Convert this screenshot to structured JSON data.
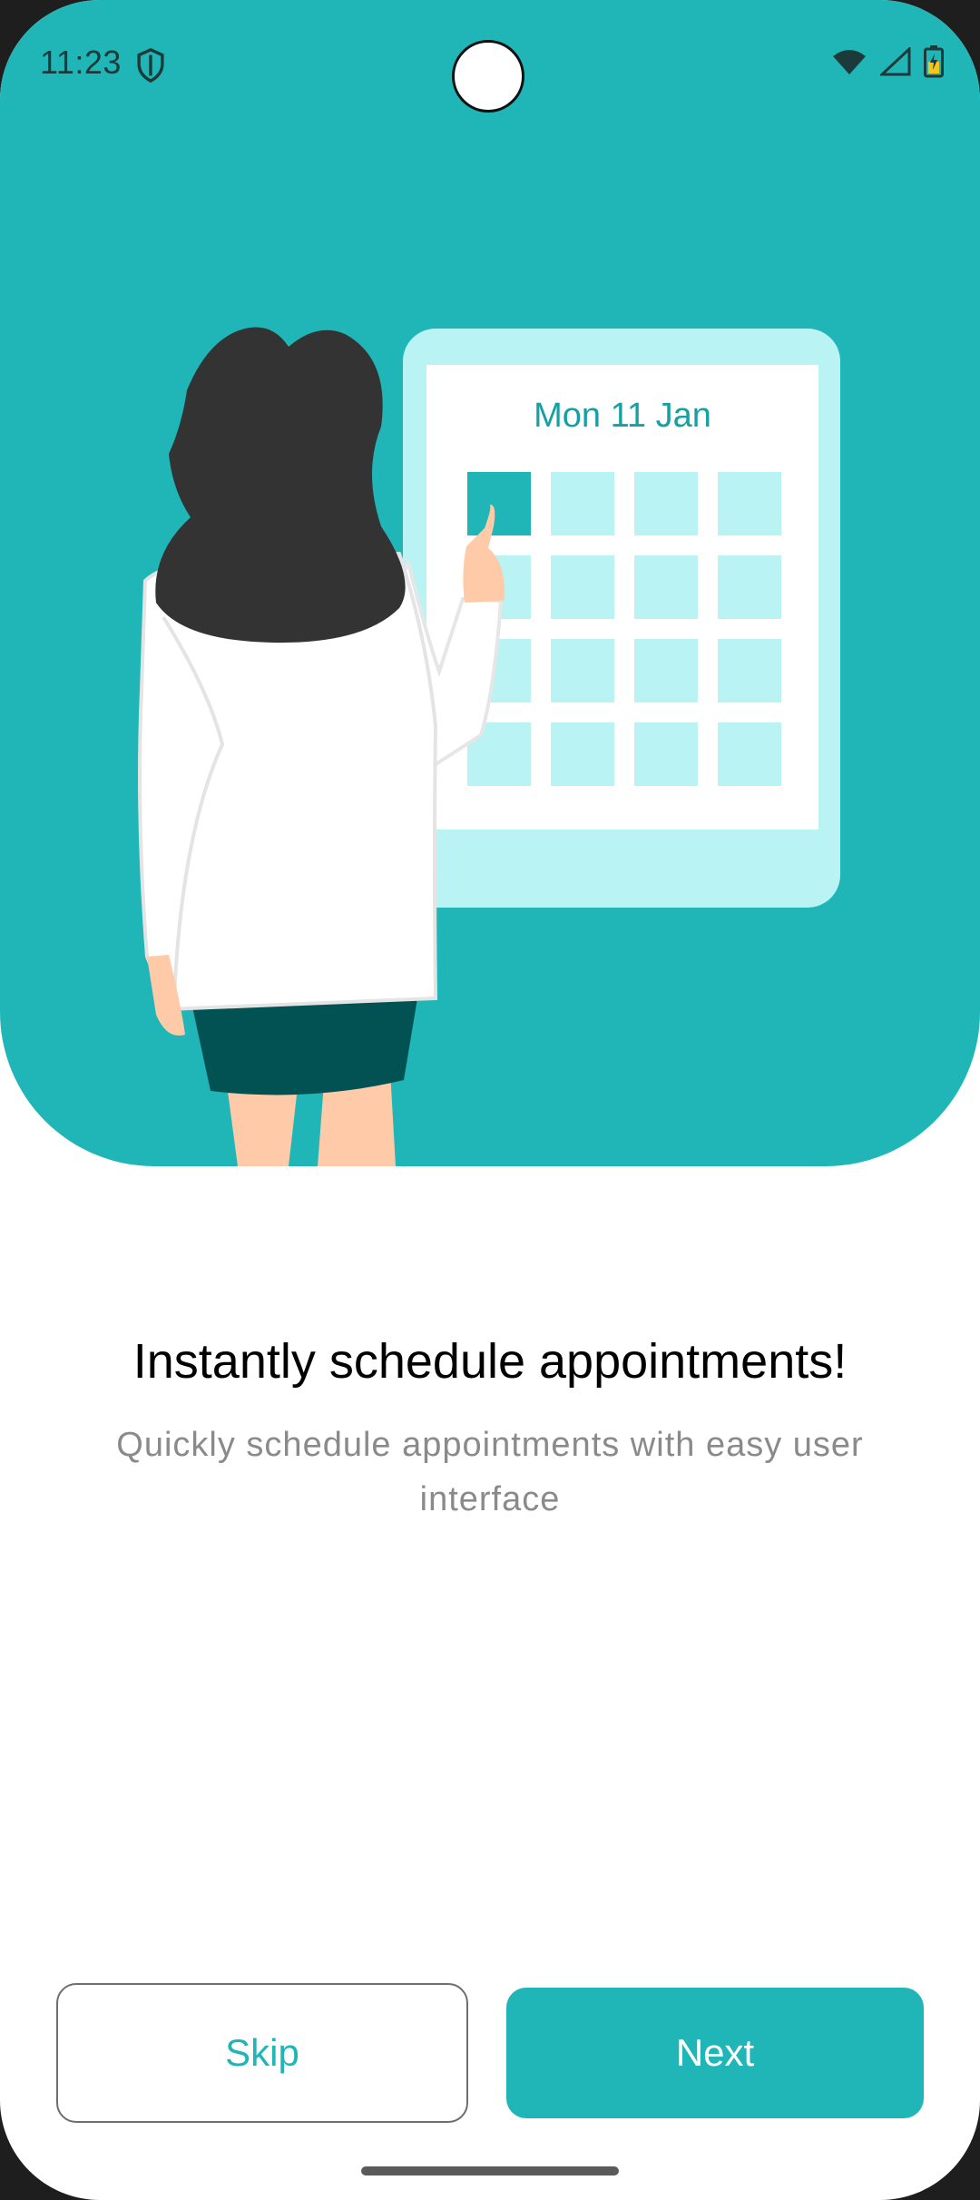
{
  "status_bar": {
    "time": "11:23",
    "icons": [
      "shield-icon",
      "wifi-icon",
      "cellular-signal-icon",
      "battery-charging-icon"
    ]
  },
  "illustration": {
    "calendar_label": "Mon 11 Jan"
  },
  "onboarding": {
    "headline": "Instantly schedule appointments!",
    "subtitle": "Quickly schedule appointments with easy user interface"
  },
  "actions": {
    "skip_label": "Skip",
    "next_label": "Next"
  },
  "colors": {
    "accent": "#20b6b8",
    "calendar_cell": "#b9f3f3",
    "skirt": "#035253",
    "hair": "#333333"
  }
}
